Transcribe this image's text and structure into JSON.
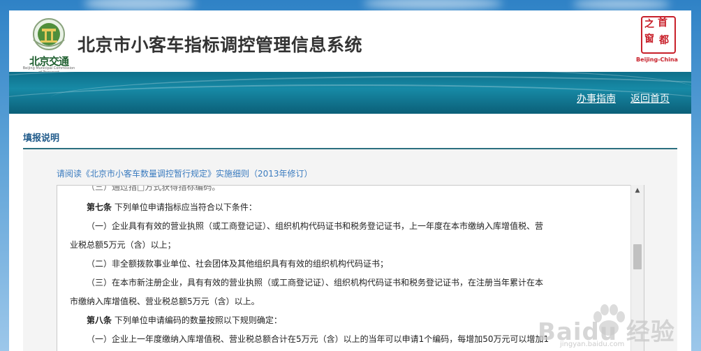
{
  "header": {
    "title": "北京市小客车指标调控管理信息系统",
    "logo_left_text": "北京交通",
    "logo_left_sub": "Beijing Municipal Commission of Transport",
    "logo_right_chars": [
      "之",
      "首",
      "窗",
      "都"
    ],
    "logo_right_text": "Beijing-China"
  },
  "nav": {
    "guide_label": "办事指南",
    "home_label": "返回首页"
  },
  "section": {
    "title": "填报说明",
    "notice_link": "请阅读《北京市小客车数量调控暂行规定》实施细则（2013年修订）"
  },
  "content": {
    "cut_line": "（三）通过指□方式获得指标编码。",
    "art7_label": "第七条",
    "art7_text": "下列单位申请指标应当符合以下条件：",
    "art7_item1_a": "（一）企业具有有效的营业执照（或工商登记证）、组织机构代码证书和税务登记证书，上一年度在本市缴纳入库增值税、营",
    "art7_item1_b": "业税总额5万元（含）以上；",
    "art7_item2": "（二）非全额拨款事业单位、社会团体及其他组织具有有效的组织机构代码证书；",
    "art7_item3_a": "（三）在本市新注册企业，具有有效的营业执照（或工商登记证）、组织机构代码证书和税务登记证书，在注册当年累计在本",
    "art7_item3_b": "市缴纳入库增值税、营业税总额5万元（含）以上。",
    "art8_label": "第八条",
    "art8_text": "下列单位申请编码的数量按照以下规则确定：",
    "art8_item1": "（一）企业上一年度缴纳入库增值税、营业税总额合计在5万元（含）以上的当年可以申请1个编码，每增加50万元可以增加1"
  },
  "watermark": {
    "text": "Baidu 经验",
    "sub": "jingyan.baidu.com"
  },
  "colors": {
    "accent": "#1f5a8a",
    "banner": "#0e6f8a",
    "link": "#3a7bbf",
    "seal": "#c8202a"
  }
}
